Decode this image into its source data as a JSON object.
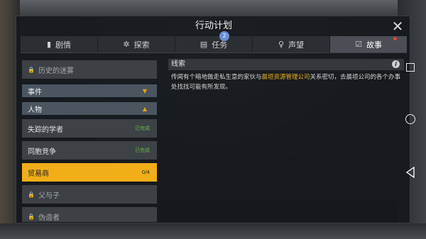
{
  "window": {
    "title": "行动计划"
  },
  "tabs": [
    {
      "label": "剧情",
      "icon": "book-icon",
      "glyph": "▮"
    },
    {
      "label": "探索",
      "icon": "compass-icon",
      "glyph": "✲"
    },
    {
      "label": "任务",
      "icon": "task-icon",
      "glyph": "▤",
      "badge": "2"
    },
    {
      "label": "声望",
      "icon": "reputation-icon",
      "glyph": "♀"
    },
    {
      "label": "故事",
      "icon": "story-icon",
      "glyph": "☑",
      "active": true
    }
  ],
  "list": {
    "locked_top": "历史的迷雾",
    "category_events": "事件",
    "category_people": "人物",
    "items": [
      {
        "label": "失踪的学者",
        "status": "已完成"
      },
      {
        "label": "同胞竞争",
        "status": "已完成"
      },
      {
        "label": "贸易商",
        "status": "0/4"
      }
    ],
    "locked_bottom_1": "父与子",
    "locked_bottom_2": "伪造者"
  },
  "clue": {
    "header": "线索",
    "text_before": "传闻有个暗地做走私生意的家伙与",
    "highlight": "晨垣资源管理公司",
    "text_after": "关系密切，去晨垣公司的各个办事处找找可能有所发现。"
  },
  "colors": {
    "accent": "#f1ae18",
    "completed": "#6ab84b",
    "badge": "#6a8fd6",
    "notify": "#e0463c"
  }
}
